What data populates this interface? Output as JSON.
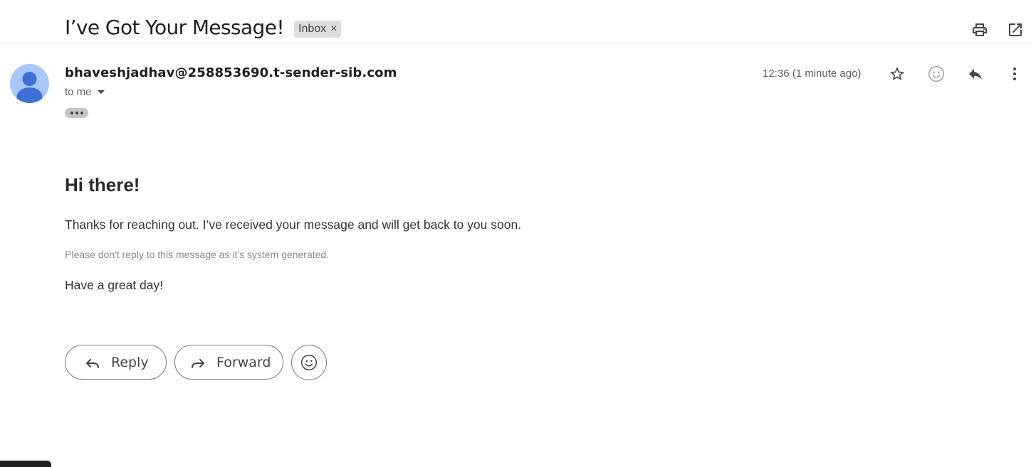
{
  "subject": "I’ve Got Your Message!",
  "label": {
    "text": "Inbox",
    "remove": "×"
  },
  "toolbar": {
    "print_icon": "print-icon",
    "open_new_window_icon": "open-in-new-icon"
  },
  "message": {
    "sender": "bhaveshjadhav@258853690.t-sender-sib.com",
    "recipient": "to me",
    "timestamp": "12:36 (1 minute ago)",
    "icons": [
      "star-icon",
      "emoji-icon",
      "reply-icon",
      "more-vert-icon"
    ]
  },
  "body": {
    "greeting": "Hi there!",
    "paragraph": "Thanks for reaching out. I’ve received your message and will get back to you soon.",
    "note": "Please don't reply to this message as it's system generated.",
    "closing": "Have a great day!"
  },
  "actions": {
    "reply_label": "Reply",
    "forward_label": "Forward"
  },
  "colors": {
    "avatar_bg": "#a8c7fa",
    "avatar_fg": "#3d6fd6",
    "chip_bg": "#dddddd",
    "icon": "#444746"
  }
}
